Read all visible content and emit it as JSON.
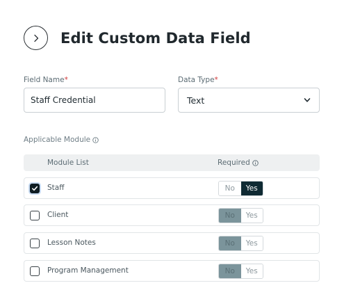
{
  "header": {
    "title": "Edit Custom Data Field",
    "back_icon": "chevron-right-icon"
  },
  "form": {
    "field_name": {
      "label": "Field Name",
      "required_mark": "*",
      "value": "Staff Credential"
    },
    "data_type": {
      "label": "Data Type",
      "required_mark": "*",
      "selected": "Text",
      "options": [
        "Text"
      ]
    }
  },
  "modules": {
    "section_label": "Applicable Module",
    "columns": {
      "module": "Module List",
      "required": "Required"
    },
    "rows": [
      {
        "name": "Staff",
        "checked": true,
        "required": "Yes",
        "enabled": true
      },
      {
        "name": "Client",
        "checked": false,
        "required": "No",
        "enabled": false
      },
      {
        "name": "Lesson Notes",
        "checked": false,
        "required": "No",
        "enabled": false
      },
      {
        "name": "Program Management",
        "checked": false,
        "required": "No",
        "enabled": false
      }
    ],
    "toggle": {
      "no": "No",
      "yes": "Yes"
    }
  },
  "colors": {
    "accent": "#0f2a33",
    "required_star": "#d23a3a",
    "disabled_toggle": "#7b949b"
  }
}
